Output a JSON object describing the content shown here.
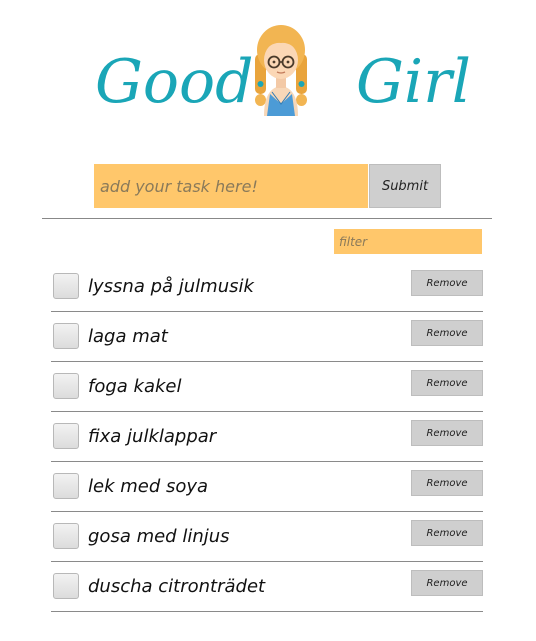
{
  "header": {
    "title_left": "Good",
    "title_right": "Girl",
    "icon": "girl-avatar-icon",
    "title_color": "#1aa6b7"
  },
  "task_form": {
    "placeholder": "add your task here!",
    "value": "",
    "submit_label": "Submit"
  },
  "filter": {
    "placeholder": "filter",
    "value": ""
  },
  "colors": {
    "input_background": "#ffc76b",
    "button_background": "#cfcfcf"
  },
  "tasks": [
    {
      "text": "lyssna på julmusik",
      "checked": false,
      "remove_label": "Remove"
    },
    {
      "text": "laga mat",
      "checked": false,
      "remove_label": "Remove"
    },
    {
      "text": "foga kakel",
      "checked": false,
      "remove_label": "Remove"
    },
    {
      "text": "fixa julklappar",
      "checked": false,
      "remove_label": "Remove"
    },
    {
      "text": "lek med soya",
      "checked": false,
      "remove_label": "Remove"
    },
    {
      "text": "gosa med linjus",
      "checked": false,
      "remove_label": "Remove"
    },
    {
      "text": "duscha citronträdet",
      "checked": false,
      "remove_label": "Remove"
    }
  ]
}
